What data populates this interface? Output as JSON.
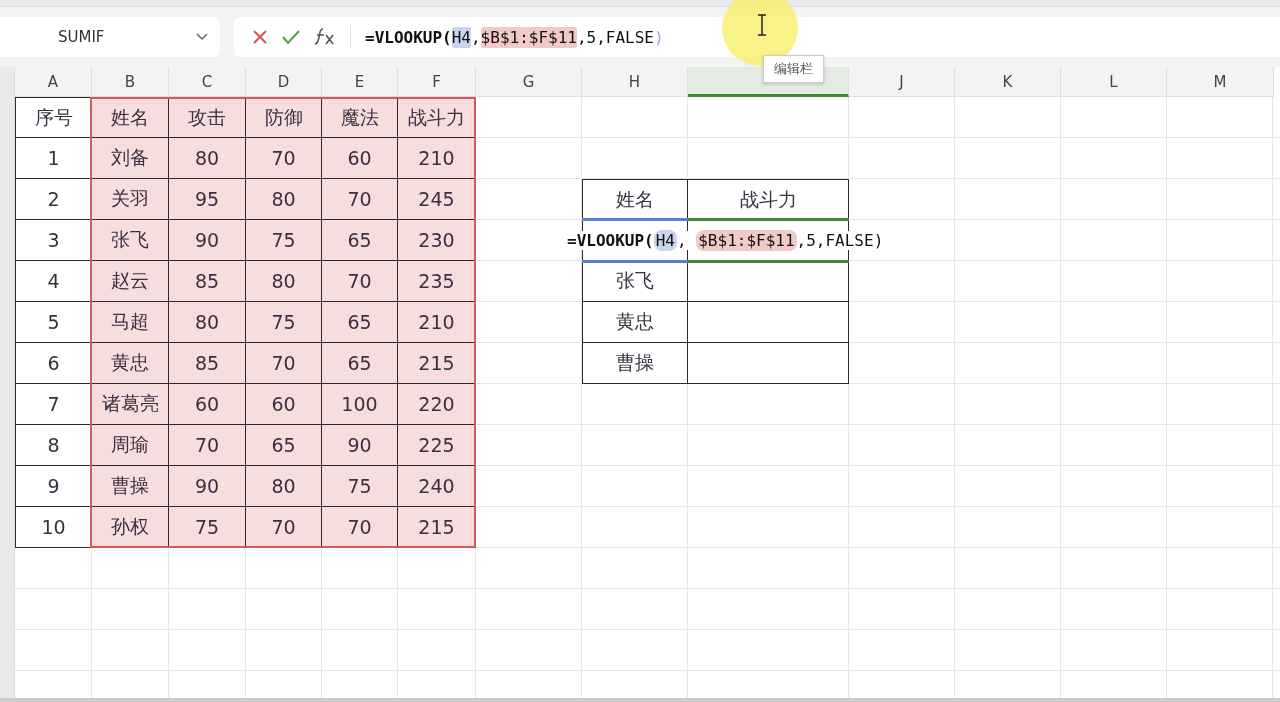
{
  "name_box": {
    "value": "SUMIF"
  },
  "formula_bar": {
    "segments": [
      {
        "kind": "func",
        "text": "=VLOOKUP("
      },
      {
        "kind": "ref",
        "text": "H4",
        "color": "#c9d5ec"
      },
      {
        "kind": "text",
        "text": ","
      },
      {
        "kind": "ref",
        "text": "$B$1:$F$11",
        "color": "#f1c9c6"
      },
      {
        "kind": "text",
        "text": ",5,FALSE"
      },
      {
        "kind": "paren",
        "text": ")"
      }
    ]
  },
  "tooltip": {
    "text": "编辑栏"
  },
  "columns": [
    {
      "label": "A",
      "selected": false
    },
    {
      "label": "B",
      "selected": false
    },
    {
      "label": "C",
      "selected": false
    },
    {
      "label": "D",
      "selected": false
    },
    {
      "label": "E",
      "selected": false
    },
    {
      "label": "F",
      "selected": false
    },
    {
      "label": "G",
      "selected": false
    },
    {
      "label": "H",
      "selected": false
    },
    {
      "selected": true
    },
    {
      "label": "J",
      "selected": false
    },
    {
      "label": "K",
      "selected": false
    },
    {
      "label": "L",
      "selected": false
    },
    {
      "label": "M",
      "selected": false
    }
  ],
  "table": {
    "columns": [
      "序号",
      "姓名",
      "攻击",
      "防御",
      "魔法",
      "战斗力"
    ],
    "rows": [
      [
        "1",
        "刘备",
        "80",
        "70",
        "60",
        "210"
      ],
      [
        "2",
        "关羽",
        "95",
        "80",
        "70",
        "245"
      ],
      [
        "3",
        "张飞",
        "90",
        "75",
        "65",
        "230"
      ],
      [
        "4",
        "赵云",
        "85",
        "80",
        "70",
        "235"
      ],
      [
        "5",
        "马超",
        "80",
        "75",
        "65",
        "210"
      ],
      [
        "6",
        "黄忠",
        "85",
        "70",
        "65",
        "215"
      ],
      [
        "7",
        "诸葛亮",
        "60",
        "60",
        "100",
        "220"
      ],
      [
        "8",
        "周瑜",
        "70",
        "65",
        "90",
        "225"
      ],
      [
        "9",
        "曹操",
        "90",
        "80",
        "75",
        "240"
      ],
      [
        "10",
        "孙权",
        "75",
        "70",
        "70",
        "215"
      ]
    ]
  },
  "lookup": {
    "columns": [
      "姓名",
      "战斗力"
    ],
    "editor": {
      "segments": [
        {
          "kind": "func",
          "text": "=VLOOKUP("
        },
        {
          "kind": "ref",
          "text": "H4",
          "color": "#c9d5ec"
        },
        {
          "kind": "text",
          "text": ", "
        },
        {
          "kind": "ref",
          "text": "$B$1:$F$11",
          "color": "#f1c9c6"
        },
        {
          "kind": "text",
          "text": ",5,FALSE"
        },
        {
          "kind": "paren",
          "text": ")"
        }
      ]
    },
    "rows": [
      {
        "name": "张飞"
      },
      {
        "name": "黄忠"
      },
      {
        "name": "曹操"
      }
    ]
  }
}
